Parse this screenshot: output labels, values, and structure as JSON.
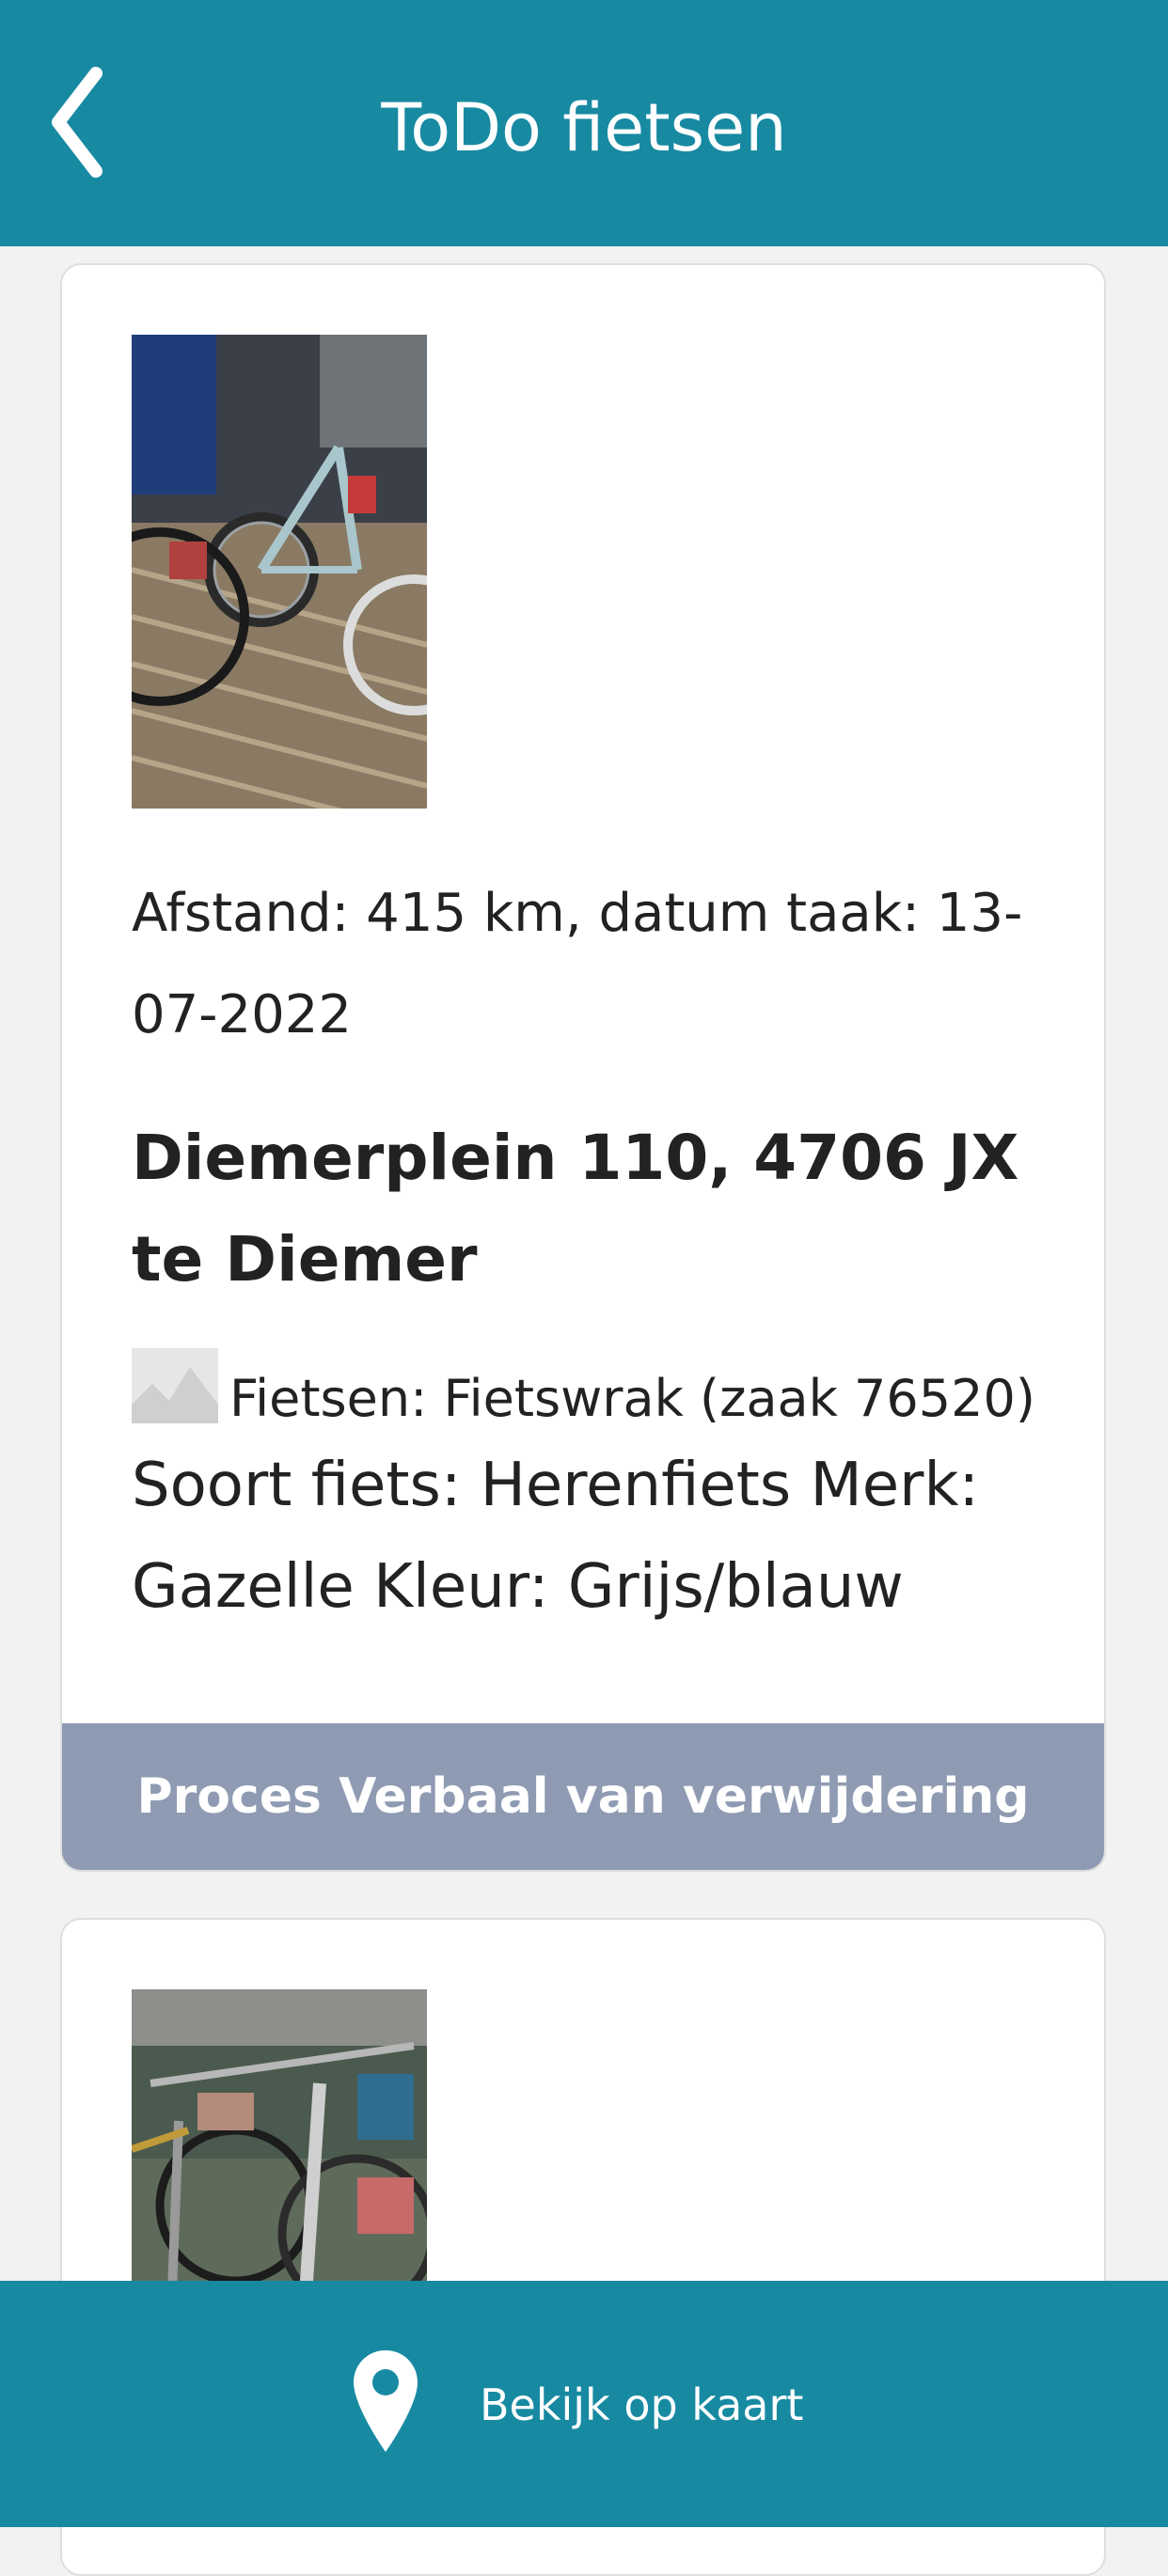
{
  "header": {
    "title": "ToDo fietsen",
    "back_icon": "chevron-left-icon"
  },
  "cards": [
    {
      "distance_line": "Afstand: 415 km, datum taak: 13-07-2022",
      "address": "Diemerplein 110, 4706 JX te Diemer",
      "case_line": "Fietsen: Fietswrak (zaak 76520)",
      "bike_description": "Soort fiets: Herenfiets Merk: Gazelle Kleur: Grijs/blauw",
      "action_label": "Proces Verbaal van verwijdering"
    }
  ],
  "footer": {
    "map_label": "Bekijk op kaart",
    "map_icon": "map-pin-icon"
  },
  "colors": {
    "primary": "#178aa2",
    "button": "#8f9bb2",
    "background": "#f2f2f2"
  }
}
